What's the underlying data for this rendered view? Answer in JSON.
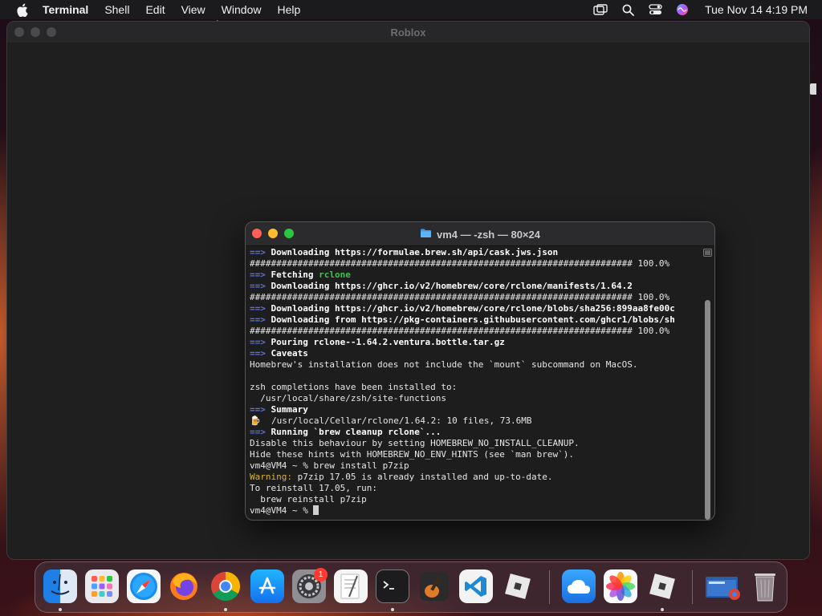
{
  "menubar": {
    "app_name": "Terminal",
    "items": [
      "Shell",
      "Edit",
      "View",
      "Window",
      "Help"
    ],
    "clock": "Tue Nov 14  4:19 PM",
    "status_icons": [
      "screen-mirroring-icon",
      "spotlight-search-icon",
      "control-center-icon",
      "siri-icon"
    ]
  },
  "roblox_window": {
    "title": "Roblox"
  },
  "terminal": {
    "title": "vm4 — -zsh — 80×24",
    "lines": [
      [
        {
          "t": "==>",
          "c": "arrow"
        },
        {
          "t": " Downloading https://formulae.brew.sh/api/cask.jws.json",
          "c": "bold"
        }
      ],
      [
        {
          "t": "######################################################################## 100.0%",
          "c": ""
        }
      ],
      [
        {
          "t": "==>",
          "c": "arrow"
        },
        {
          "t": " Fetching ",
          "c": "bold"
        },
        {
          "t": "rclone",
          "c": "green"
        }
      ],
      [
        {
          "t": "==>",
          "c": "arrow"
        },
        {
          "t": " Downloading https://ghcr.io/v2/homebrew/core/rclone/manifests/1.64.2",
          "c": "bold"
        }
      ],
      [
        {
          "t": "######################################################################## 100.0%",
          "c": ""
        }
      ],
      [
        {
          "t": "==>",
          "c": "arrow"
        },
        {
          "t": " Downloading https://ghcr.io/v2/homebrew/core/rclone/blobs/sha256:899aa8fe00c",
          "c": "bold"
        }
      ],
      [
        {
          "t": "==>",
          "c": "arrow"
        },
        {
          "t": " Downloading from https://pkg-containers.githubusercontent.com/ghcr1/blobs/sh",
          "c": "bold"
        }
      ],
      [
        {
          "t": "######################################################################## 100.0%",
          "c": ""
        }
      ],
      [
        {
          "t": "==>",
          "c": "arrow"
        },
        {
          "t": " Pouring rclone--1.64.2.ventura.bottle.tar.gz",
          "c": "bold"
        }
      ],
      [
        {
          "t": "==>",
          "c": "arrow"
        },
        {
          "t": " Caveats",
          "c": "bold"
        }
      ],
      [
        {
          "t": "Homebrew's installation does not include the `mount` subcommand on MacOS.",
          "c": ""
        }
      ],
      [
        {
          "t": "",
          "c": ""
        }
      ],
      [
        {
          "t": "zsh completions have been installed to:",
          "c": ""
        }
      ],
      [
        {
          "t": "  /usr/local/share/zsh/site-functions",
          "c": ""
        }
      ],
      [
        {
          "t": "==>",
          "c": "arrow"
        },
        {
          "t": " Summary",
          "c": "bold"
        }
      ],
      [
        {
          "t": "🍺",
          "c": ""
        },
        {
          "t": "  /usr/local/Cellar/rclone/1.64.2: 10 files, 73.6MB",
          "c": ""
        }
      ],
      [
        {
          "t": "==>",
          "c": "arrow"
        },
        {
          "t": " Running `brew cleanup rclone`...",
          "c": "bold"
        }
      ],
      [
        {
          "t": "Disable this behaviour by setting HOMEBREW_NO_INSTALL_CLEANUP.",
          "c": ""
        }
      ],
      [
        {
          "t": "Hide these hints with HOMEBREW_NO_ENV_HINTS (see `man brew`).",
          "c": ""
        }
      ],
      [
        {
          "t": "vm4@VM4 ~ % brew install p7zip",
          "c": ""
        }
      ],
      [
        {
          "t": "Warning:",
          "c": "warn"
        },
        {
          "t": " p7zip 17.05 is already installed and up-to-date.",
          "c": ""
        }
      ],
      [
        {
          "t": "To reinstall 17.05, run:",
          "c": ""
        }
      ],
      [
        {
          "t": "  brew reinstall p7zip",
          "c": ""
        }
      ],
      [
        {
          "t": "vm4@VM4 ~ % ",
          "c": ""
        }
      ]
    ]
  },
  "dock": {
    "apps": [
      {
        "name": "finder-icon",
        "running": true
      },
      {
        "name": "launchpad-icon",
        "running": false
      },
      {
        "name": "safari-icon",
        "running": false
      },
      {
        "name": "firefox-icon",
        "running": false
      },
      {
        "name": "chrome-icon",
        "running": true
      },
      {
        "name": "app-store-icon",
        "running": false
      },
      {
        "name": "system-settings-icon",
        "running": false,
        "badge": "1"
      },
      {
        "name": "textedit-icon",
        "running": false
      },
      {
        "name": "terminal-icon",
        "running": true
      },
      {
        "name": "garageband-icon",
        "running": false
      },
      {
        "name": "vscode-icon",
        "running": false
      },
      {
        "name": "roblox-icon",
        "running": false
      },
      {
        "name": "icloud-icon",
        "running": false
      },
      {
        "name": "photos-icon",
        "running": false
      },
      {
        "name": "roblox-studio-icon",
        "running": true
      },
      {
        "name": "downloads-stack-icon",
        "running": false
      },
      {
        "name": "trash-icon",
        "running": false
      }
    ]
  }
}
